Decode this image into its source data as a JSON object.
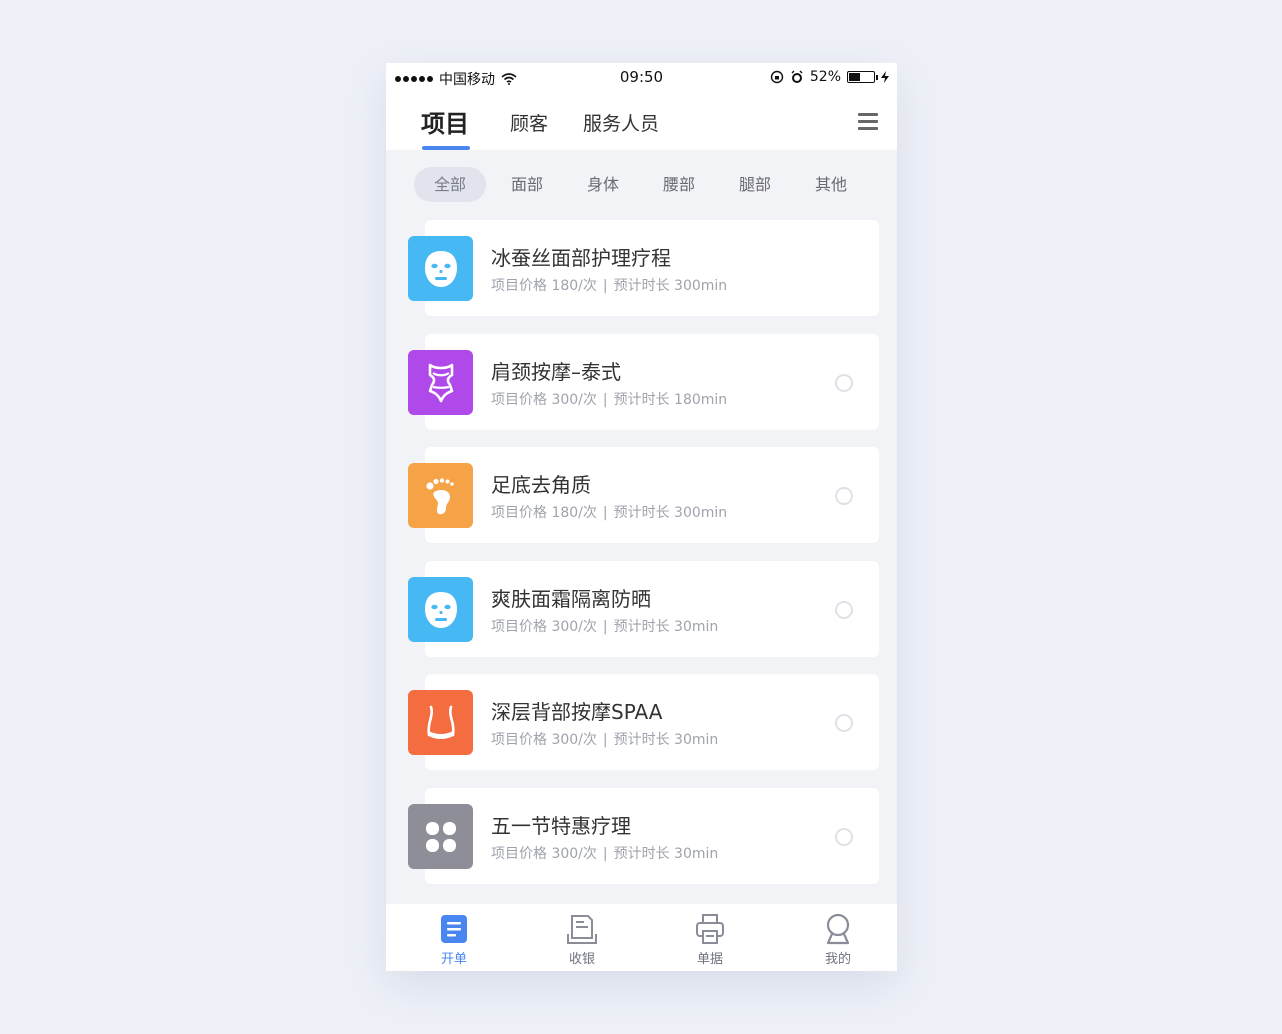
{
  "statusbar": {
    "carrier": "中国移动",
    "time": "09:50",
    "battery": "52%",
    "battery_level": 0.52
  },
  "topnav": {
    "tabs": [
      {
        "label": "项目",
        "active": true
      },
      {
        "label": "顾客",
        "active": false
      },
      {
        "label": "服务人员",
        "active": false
      }
    ],
    "menu_icon": "hamburger-icon"
  },
  "filters": [
    {
      "label": "全部",
      "active": true
    },
    {
      "label": "面部",
      "active": false
    },
    {
      "label": "身体",
      "active": false
    },
    {
      "label": "腰部",
      "active": false
    },
    {
      "label": "腿部",
      "active": false
    },
    {
      "label": "其他",
      "active": false
    }
  ],
  "items": [
    {
      "title": "冰蚕丝面部护理疗程",
      "price": "项目价格 180/次",
      "duration": "预计时长 300min",
      "icon": "face-mask-icon",
      "color": "#46b8f3",
      "selectable": false
    },
    {
      "title": "肩颈按摩–泰式",
      "price": "项目价格 300/次",
      "duration": "预计时长 180min",
      "icon": "body-icon",
      "color": "#b049ea",
      "selectable": true
    },
    {
      "title": "足底去角质",
      "price": "项目价格 180/次",
      "duration": "预计时长 300min",
      "icon": "foot-icon",
      "color": "#f6a347",
      "selectable": true
    },
    {
      "title": "爽肤面霜隔离防晒",
      "price": "项目价格 300/次",
      "duration": "预计时长 30min",
      "icon": "face-mask-icon",
      "color": "#46b8f3",
      "selectable": true
    },
    {
      "title": "深层背部按摩SPAA",
      "price": "项目价格 300/次",
      "duration": "预计时长 30min",
      "icon": "waist-icon",
      "color": "#f36d40",
      "selectable": true
    },
    {
      "title": "五一节特惠疗理",
      "price": "项目价格 300/次",
      "duration": "预计时长 30min",
      "icon": "clover-icon",
      "color": "#8d8e98",
      "selectable": true
    }
  ],
  "tabbar": [
    {
      "label": "开单",
      "icon": "order-icon",
      "active": true
    },
    {
      "label": "收银",
      "icon": "cashier-icon",
      "active": false
    },
    {
      "label": "单据",
      "icon": "printer-icon",
      "active": false
    },
    {
      "label": "我的",
      "icon": "profile-icon",
      "active": false
    }
  ],
  "colors": {
    "accent": "#4a86f0",
    "background": "#f2f3f7"
  }
}
